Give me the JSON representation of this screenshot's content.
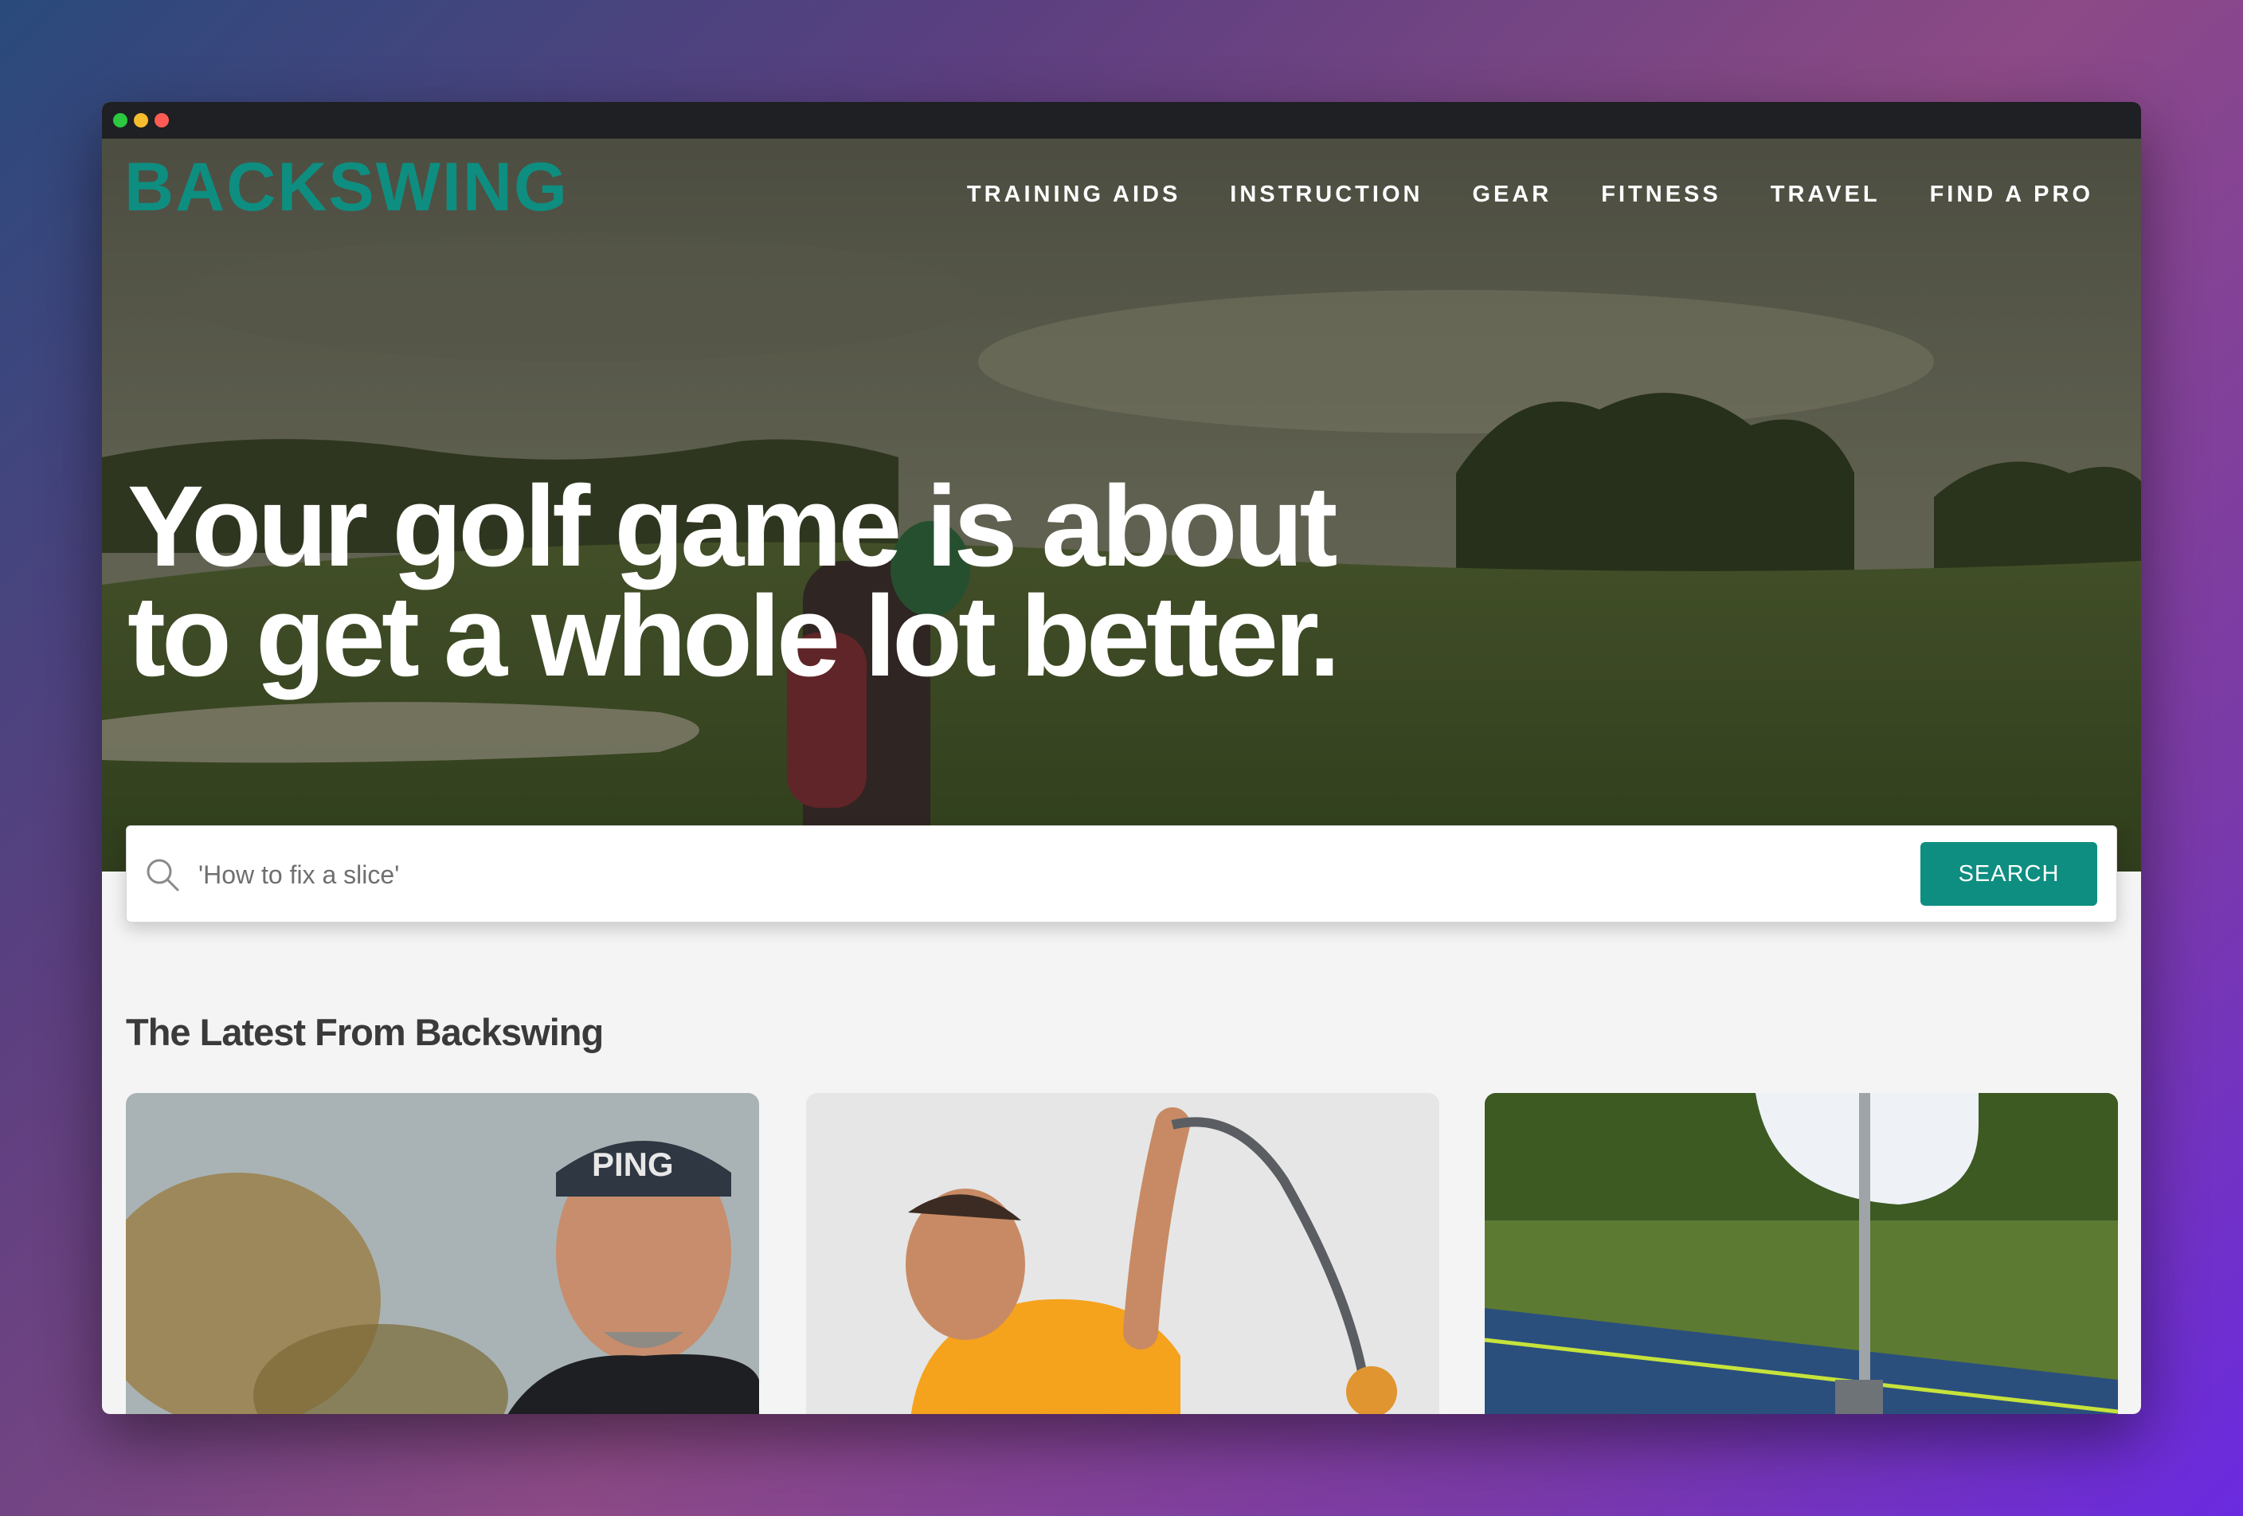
{
  "window": {
    "controls": [
      {
        "name": "green",
        "color": "#2bc840"
      },
      {
        "name": "yellow",
        "color": "#f5bd2e"
      },
      {
        "name": "red",
        "color": "#ff5b55"
      }
    ]
  },
  "brand": {
    "logo_text": "BACKSWING",
    "accent": "#0e8e80"
  },
  "nav": {
    "items": [
      {
        "label": "TRAINING AIDS"
      },
      {
        "label": "INSTRUCTION"
      },
      {
        "label": "GEAR"
      },
      {
        "label": "FITNESS"
      },
      {
        "label": "TRAVEL"
      },
      {
        "label": "FIND A PRO"
      }
    ]
  },
  "hero": {
    "headline_line1": "Your golf game is about",
    "headline_line2": "to get a whole lot better."
  },
  "search": {
    "placeholder": "'How to fix a slice'",
    "button_label": "SEARCH",
    "icon": "search-icon"
  },
  "latest": {
    "title": "The Latest From Backswing",
    "cards": [
      {
        "image": "golf-pro-portrait",
        "cap_text": "PING"
      },
      {
        "image": "swing-trainer-golfer"
      },
      {
        "image": "putting-mat-closeup"
      }
    ]
  }
}
